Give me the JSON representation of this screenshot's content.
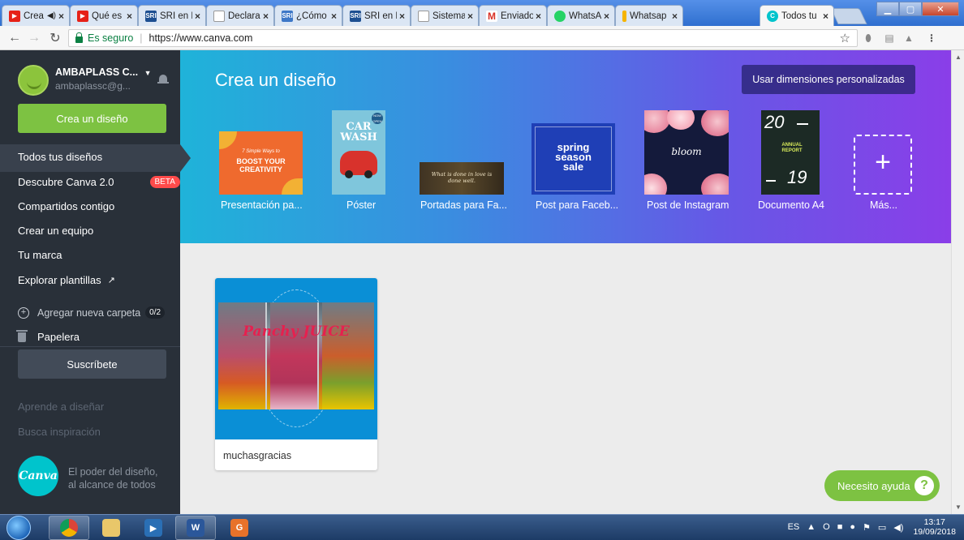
{
  "browser": {
    "tabs": [
      {
        "label": "Crea",
        "icon": "youtube-icon",
        "color": "#e62117",
        "muted": true
      },
      {
        "label": "Qué es C",
        "icon": "youtube-icon",
        "color": "#e62117"
      },
      {
        "label": "SRI en Lí",
        "icon": "sri-icon",
        "color": "#1d4f91"
      },
      {
        "label": "Declarac",
        "icon": "document-icon",
        "color": "#ffffff"
      },
      {
        "label": "¿Cómo p",
        "icon": "sri-icon",
        "color": "#3d77c7"
      },
      {
        "label": "SRI en Lí",
        "icon": "sri-icon",
        "color": "#1d4f91"
      },
      {
        "label": "Sistema",
        "icon": "document-icon",
        "color": "#ffffff"
      },
      {
        "label": "Enviados",
        "icon": "gmail-icon",
        "color": "#d93025"
      },
      {
        "label": "WhatsAp",
        "icon": "whatsapp-icon",
        "color": "#25d366"
      },
      {
        "label": "Whatsap",
        "icon": "bookmark-icon",
        "color": "#f5b400"
      },
      {
        "label": "Todos tu",
        "icon": "canva-icon",
        "color": "#00c4cc"
      }
    ],
    "secure_label": "Es seguro",
    "url": "https://www.canva.com"
  },
  "sidebar": {
    "account_name": "AMBAPLASS C...",
    "account_email": "ambaplassc@g...",
    "create_button": "Crea un diseño",
    "nav": {
      "all_designs": "Todos tus diseños",
      "discover": "Descubre Canva 2.0",
      "beta": "BETA",
      "shared": "Compartidos contigo",
      "team": "Crear un equipo",
      "brand": "Tu marca",
      "templates": "Explorar plantillas",
      "templates_arrow": "↗"
    },
    "add_folder": "Agregar nueva carpeta",
    "folder_count": "0/2",
    "trash": "Papelera",
    "subscribe": "Suscríbete",
    "learn": "Aprende a diseñar",
    "inspiration": "Busca inspiración",
    "logo_text": "Canva",
    "tagline_1": "El poder del diseño,",
    "tagline_2": "al alcance de todos"
  },
  "banner": {
    "title": "Crea un diseño",
    "custom_dimensions": "Usar dimensiones personalizadas",
    "templates": [
      {
        "label": "Presentación pa...",
        "thumb_text": "BOOST YOUR CREATIVITY",
        "thumb_small": "7 Simple Ways to"
      },
      {
        "label": "Póster",
        "thumb_text": "CAR WASH",
        "thumb_small": "NOW OPEN"
      },
      {
        "label": "Portadas para Fa...",
        "thumb_text": "What is done in love is done well."
      },
      {
        "label": "Post para Faceb...",
        "thumb_text": "spring season sale"
      },
      {
        "label": "Post de Instagram",
        "thumb_text": "bloom"
      },
      {
        "label": "Documento A4",
        "thumb_text": "20",
        "thumb_text2": "ANNUAL REPORT",
        "thumb_text3": "19"
      },
      {
        "label": "Más...",
        "thumb_text": "+"
      }
    ]
  },
  "designs": [
    {
      "title": "muchasgracias",
      "thumb_text": "Panchy JUICE"
    }
  ],
  "help_button": "Necesito ayuda",
  "help_icon": "?",
  "taskbar": {
    "lang": "ES",
    "time": "13:17",
    "date": "19/09/2018"
  }
}
